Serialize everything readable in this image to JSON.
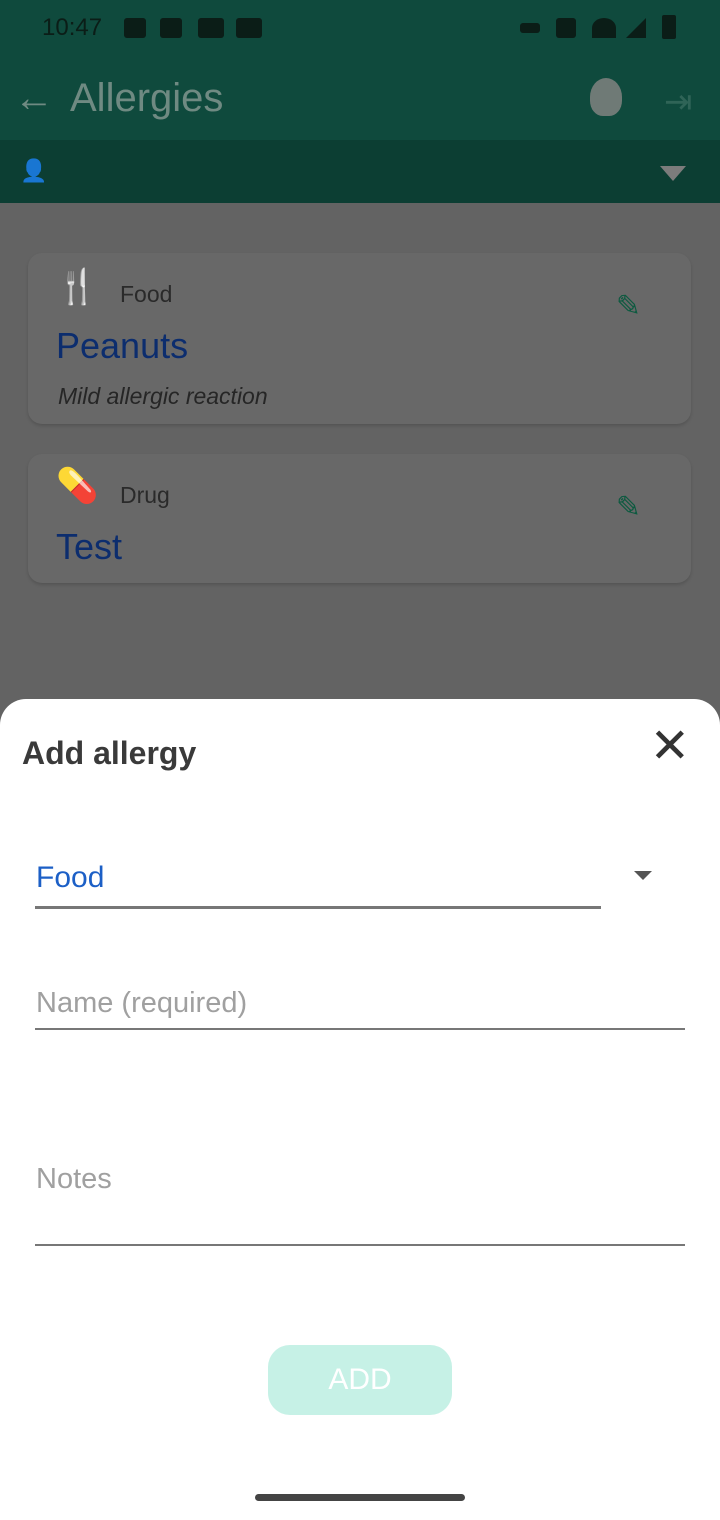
{
  "status_bar": {
    "time": "10:47"
  },
  "app_bar": {
    "title": "Allergies",
    "back_icon": "arrow-left-icon",
    "actions": [
      "lightbulb-icon",
      "exit-icon"
    ]
  },
  "profile_bar": {
    "icon": "person-icon",
    "dropdown_icon": "triangle-down-icon"
  },
  "allergies": [
    {
      "category": "Food",
      "name": "Peanuts",
      "note": "Mild allergic reaction",
      "icon": "utensils-icon"
    },
    {
      "category": "Drug",
      "name": "Test",
      "note": "",
      "icon": "pill-bottle-icon"
    }
  ],
  "sheet": {
    "title": "Add allergy",
    "type_value": "Food",
    "name_placeholder": "Name (required)",
    "notes_placeholder": "Notes",
    "add_label": "ADD",
    "colors": {
      "accent": "#1c5fc6",
      "button": "#c6f1e6",
      "header": "#0f4a3d"
    }
  }
}
